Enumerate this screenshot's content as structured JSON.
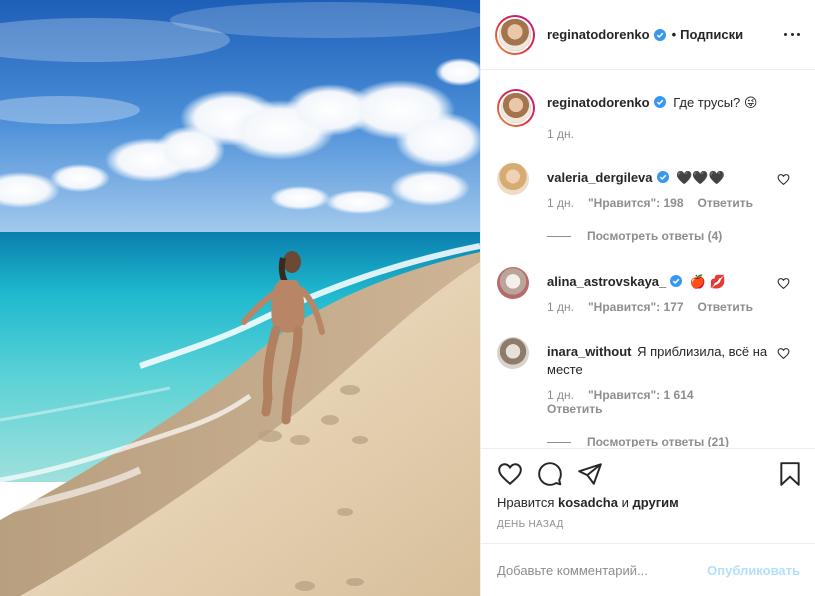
{
  "header": {
    "username": "reginatodorenko",
    "dot": "•",
    "follow_label": "Подписки"
  },
  "caption": {
    "username": "reginatodorenko",
    "text": "Где трусы? 😜",
    "time": "1 дн."
  },
  "comments": [
    {
      "username": "valeria_dergileva",
      "text": "🖤🖤🖤",
      "time": "1 дн.",
      "likes": "\"Нравится\": 198",
      "reply": "Ответить",
      "view_replies": "Посмотреть ответы (4)"
    },
    {
      "username": "alina_astrovskaya_",
      "text": "🍎 💋",
      "time": "1 дн.",
      "likes": "\"Нравится\": 177",
      "reply": "Ответить"
    },
    {
      "username": "inara_without",
      "text": "Я приблизила, всё на месте",
      "time": "1 дн.",
      "likes": "\"Нравится\": 1 614",
      "reply": "Ответить",
      "view_replies": "Посмотреть ответы (21)"
    }
  ],
  "actions": {
    "likes_prefix": "Нравится",
    "likes_user": "kosadcha",
    "likes_and": "и",
    "likes_others": "другим",
    "date": "День назад"
  },
  "add_comment": {
    "placeholder": "Добавьте комментарий...",
    "publish": "Опубликовать"
  },
  "colors": {
    "verified": "#3897f0",
    "publish_disabled": "#b2dffc",
    "meta_grey": "#8e8e8e"
  },
  "icons": [
    "heart-icon",
    "comment-icon",
    "share-icon",
    "bookmark-icon",
    "more-icon",
    "verified-icon"
  ]
}
